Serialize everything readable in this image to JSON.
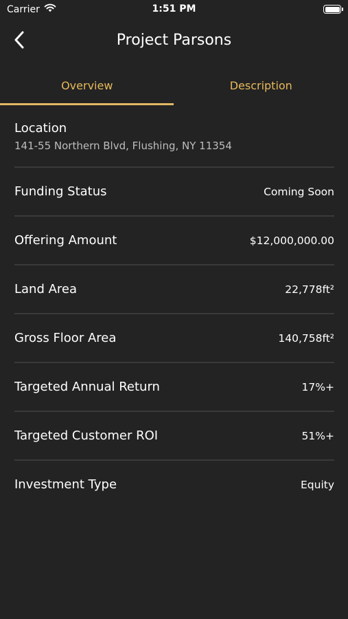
{
  "status_bar": {
    "carrier": "Carrier",
    "time": "1:51 PM",
    "battery_level": 1.0,
    "icons": [
      "wifi-icon",
      "battery-icon"
    ]
  },
  "nav": {
    "title": "Project Parsons",
    "back_icon": "chevron-left-icon"
  },
  "tabs": [
    {
      "label": "Overview",
      "selected": true
    },
    {
      "label": "Description",
      "selected": false
    }
  ],
  "location": {
    "label": "Location",
    "value": "141-55 Northern Blvd, Flushing, NY 11354"
  },
  "rows": [
    {
      "label": "Funding Status",
      "value": "Coming Soon"
    },
    {
      "label": "Offering Amount",
      "value": "$12,000,000.00"
    },
    {
      "label": "Land Area",
      "value": "22,778ft²"
    },
    {
      "label": "Gross Floor Area",
      "value": "140,758ft²"
    },
    {
      "label": "Targeted Annual Return",
      "value": "17%+"
    },
    {
      "label": "Targeted Customer ROI",
      "value": "51%+"
    },
    {
      "label": "Investment Type",
      "value": "Equity"
    }
  ],
  "colors": {
    "background": "#232323",
    "accent": "#e7b95b",
    "divider": "#3a3a3a",
    "secondary_text": "#bdbdbd"
  }
}
